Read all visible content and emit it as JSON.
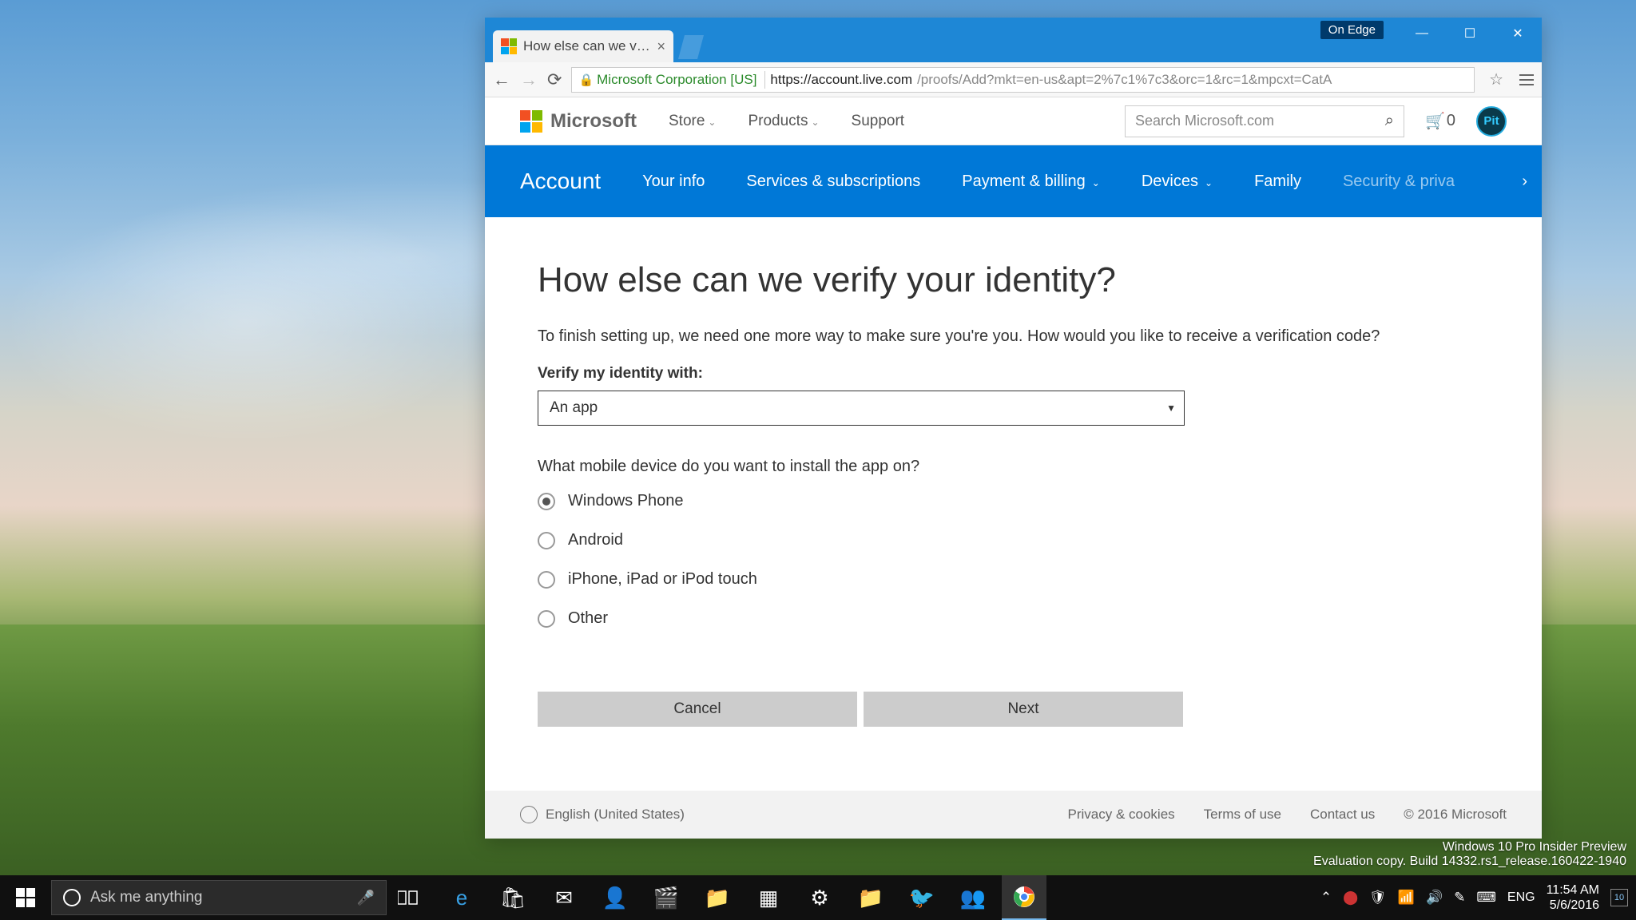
{
  "browser": {
    "tab_title": "How else can we verify yo",
    "on_edge_badge": "On Edge",
    "ssl_identity": "Microsoft Corporation [US]",
    "url_host": "https://account.live.com",
    "url_path": "/proofs/Add?mkt=en-us&apt=2%7c1%7c3&orc=1&rc=1&mpcxt=CatA"
  },
  "ms_header": {
    "brand": "Microsoft",
    "nav": [
      "Store",
      "Products",
      "Support"
    ],
    "search_placeholder": "Search Microsoft.com",
    "cart_count": "0",
    "avatar_initials": "Pit"
  },
  "subnav": {
    "brand": "Account",
    "items": [
      "Your info",
      "Services & subscriptions",
      "Payment & billing",
      "Devices",
      "Family",
      "Security & priva"
    ]
  },
  "page": {
    "heading": "How else can we verify your identity?",
    "lead": "To finish setting up, we need one more way to make sure you're you. How would you like to receive a verification code?",
    "verify_label": "Verify my identity with:",
    "select_value": "An app",
    "device_question": "What mobile device do you want to install the app on?",
    "options": [
      "Windows Phone",
      "Android",
      "iPhone, iPad or iPod touch",
      "Other"
    ],
    "cancel": "Cancel",
    "next": "Next"
  },
  "footer": {
    "language": "English (United States)",
    "links": [
      "Privacy & cookies",
      "Terms of use",
      "Contact us"
    ],
    "copyright": "© 2016 Microsoft"
  },
  "watermark": {
    "line1": "Windows 10 Pro Insider Preview",
    "line2": "Evaluation copy. Build 14332.rs1_release.160422-1940"
  },
  "taskbar": {
    "cortana_placeholder": "Ask me anything",
    "lang": "ENG",
    "time": "11:54 AM",
    "date": "5/6/2016",
    "notif_count": "10"
  }
}
